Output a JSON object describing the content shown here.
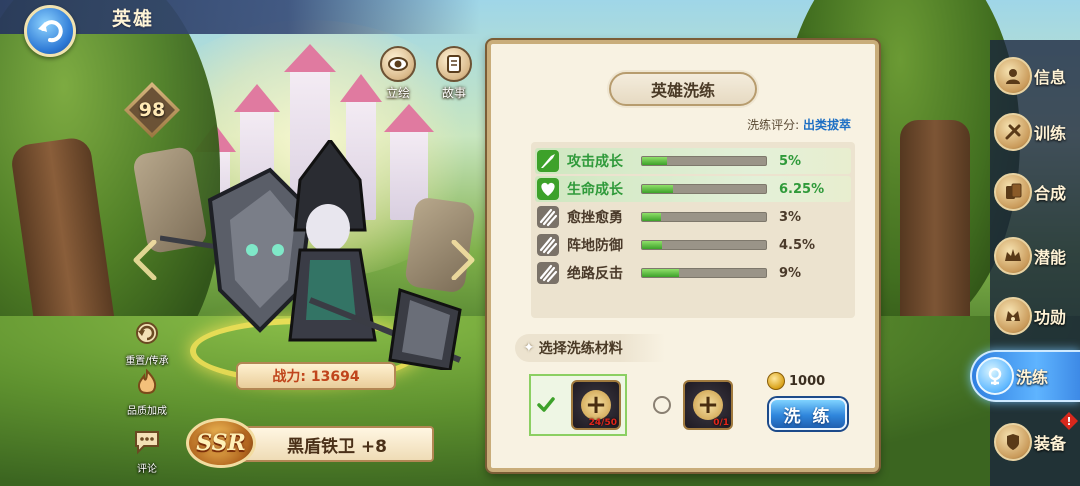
{
  "header": {
    "title": "英雄",
    "back_icon": "back-arrow-icon"
  },
  "hero": {
    "level": "98",
    "rarity": "SSR",
    "name": "黑盾铁卫 +8",
    "power_label": "战力: 13694",
    "tools_top": [
      {
        "id": "portrait",
        "label": "立绘",
        "icon": "eye-icon"
      },
      {
        "id": "story",
        "label": "故事",
        "icon": "scroll-icon"
      }
    ],
    "tools_left": [
      {
        "id": "reset",
        "label": "重置/传承",
        "icon": "reset-icon"
      },
      {
        "id": "quality",
        "label": "品质加成",
        "icon": "flame-icon"
      },
      {
        "id": "comment",
        "label": "评论",
        "icon": "chat-icon"
      }
    ]
  },
  "panel": {
    "title": "英雄洗练",
    "score_label": "洗练评分:",
    "score_value": "出类拔萃",
    "stats": [
      {
        "name": "攻击成长",
        "value": "5%",
        "fill": 0.2,
        "active": true,
        "color": "#2f9a3a",
        "icon": "sword-icon"
      },
      {
        "name": "生命成长",
        "value": "6.25%",
        "fill": 0.25,
        "active": true,
        "color": "#2f9a3a",
        "icon": "heart-icon"
      },
      {
        "name": "愈挫愈勇",
        "value": "3%",
        "fill": 0.15,
        "active": false,
        "color": "#4a3a2a",
        "icon": "claw-icon"
      },
      {
        "name": "阵地防御",
        "value": "4.5%",
        "fill": 0.16,
        "active": false,
        "color": "#4a3a2a",
        "icon": "claw-icon"
      },
      {
        "name": "绝路反击",
        "value": "9%",
        "fill": 0.3,
        "active": false,
        "color": "#4a3a2a",
        "icon": "claw-icon"
      }
    ],
    "material_header": "选择洗练材料",
    "materials": [
      {
        "count": "24/50",
        "selected": true
      },
      {
        "count": "0/1",
        "selected": false
      }
    ],
    "cost": "1000",
    "wash_button": "洗 练"
  },
  "tabs": [
    {
      "label": "信息",
      "icon": "info-icon",
      "active": false
    },
    {
      "label": "训练",
      "icon": "training-icon",
      "active": false
    },
    {
      "label": "合成",
      "icon": "cards-icon",
      "active": false
    },
    {
      "label": "潜能",
      "icon": "crown-star-icon",
      "active": false
    },
    {
      "label": "功勋",
      "icon": "laurel-icon",
      "active": false
    },
    {
      "label": "洗练",
      "icon": "refine-icon",
      "active": true
    },
    {
      "label": "装备",
      "icon": "equipment-icon",
      "active": false,
      "alert": "!"
    }
  ],
  "colors": {
    "accent_blue": "#2f86dc",
    "active_green": "#2f9a3a",
    "power_red": "#c0451c",
    "score_blue": "#1d6fc4"
  }
}
